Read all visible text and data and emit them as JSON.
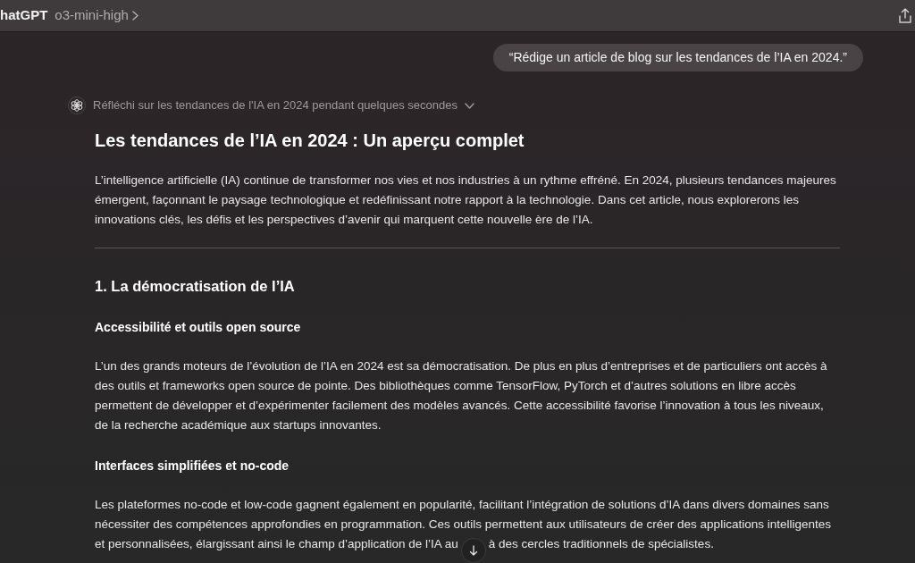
{
  "top_bar": {
    "app_name": "hatGPT",
    "model": "o3-mini-high"
  },
  "user_message": {
    "text": "“Rédige un article de blog sur les tendances de l’IA en 2024.”"
  },
  "reasoning": {
    "text": "Réfléchi sur les tendances de l'IA en 2024 pendant quelques secondes",
    "expanded": false
  },
  "article": {
    "title": "Les tendances de l’IA en 2024 : Un aperçu complet",
    "blocks": [
      {
        "kind": "paragraph",
        "text": "L’intelligence artificielle (IA) continue de transformer nos vies et nos industries à un rythme effréné. En 2024, plusieurs tendances majeures émergent, façonnant le paysage technologique et redéfinissant notre rapport à la technologie. Dans cet article, nous explorerons les innovations clés, les défis et les perspectives d’avenir qui marquent cette nouvelle ère de l’IA."
      },
      {
        "kind": "divider"
      },
      {
        "kind": "heading",
        "text": "1. La démocratisation de l’IA"
      },
      {
        "kind": "subheading",
        "text": "Accessibilité et outils open source"
      },
      {
        "kind": "paragraph",
        "text": "L’un des grands moteurs de l’évolution de l’IA en 2024 est sa démocratisation. De plus en plus d’entreprises et de particuliers ont accès à des outils et frameworks open source de pointe. Des bibliothèques comme TensorFlow, PyTorch et d’autres solutions en libre accès permettent de développer et d’expérimenter facilement des modèles avancés. Cette accessibilité favorise l’innovation à tous les niveaux, de la recherche académique aux startups innovantes."
      },
      {
        "kind": "subheading",
        "text": "Interfaces simplifiées et no-code"
      },
      {
        "kind": "paragraph",
        "text": "Les plateformes no-code et low-code gagnent également en popularité, facilitant l’intégration de solutions d’IA dans divers domaines sans nécessiter des compétences approfondies en programmation. Ces outils permettent aux utilisateurs de créer des applications intelligentes",
        "last_line_before_button": "et personnalisées, élargissant ainsi le champ d’application de l’IA au",
        "last_line_after_button": "à des cercles traditionnels de spécialistes."
      }
    ]
  }
}
